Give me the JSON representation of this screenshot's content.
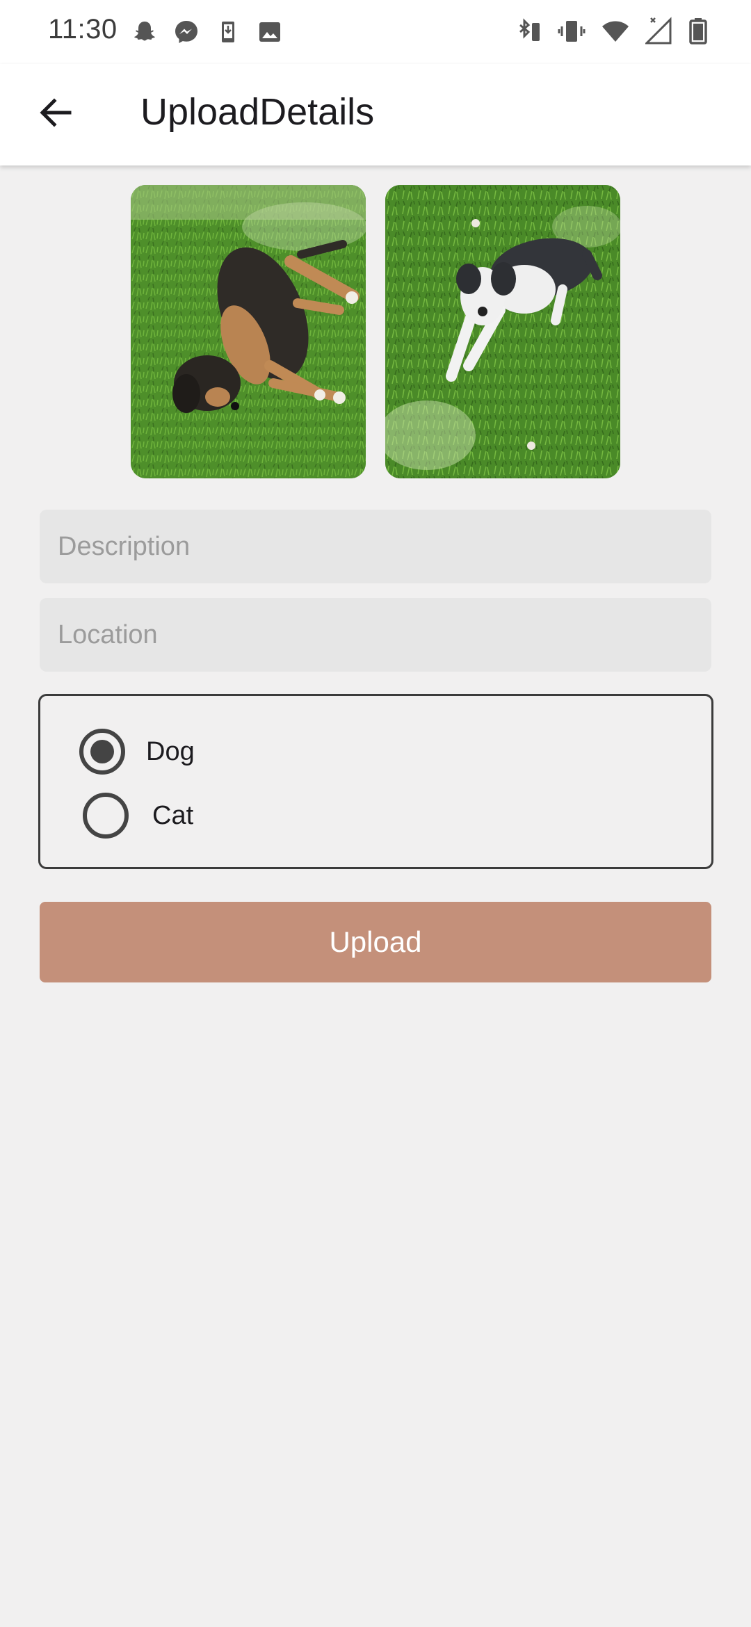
{
  "status_bar": {
    "time": "11:30",
    "left_icons": [
      "snapchat-icon",
      "messenger-icon",
      "download-icon",
      "image-icon"
    ],
    "right_icons": [
      "bluetooth-battery-icon",
      "vibrate-icon",
      "wifi-icon",
      "signal-icon",
      "battery-icon"
    ]
  },
  "app_bar": {
    "title": "UploadDetails",
    "back_icon": "arrow-back-icon"
  },
  "photos": [
    {
      "subject": "dog-photo-1"
    },
    {
      "subject": "dog-photo-2"
    }
  ],
  "form": {
    "description": {
      "placeholder": "Description",
      "value": ""
    },
    "location": {
      "placeholder": "Location",
      "value": ""
    },
    "animal_type": {
      "options": [
        {
          "label": "Dog",
          "selected": true
        },
        {
          "label": "Cat",
          "selected": false
        }
      ]
    },
    "upload_label": "Upload"
  },
  "colors": {
    "background": "#f1f0f0",
    "app_bar": "#ffffff",
    "field": "#e6e6e6",
    "upload_button": "#c4907a",
    "radio": "#444444"
  }
}
